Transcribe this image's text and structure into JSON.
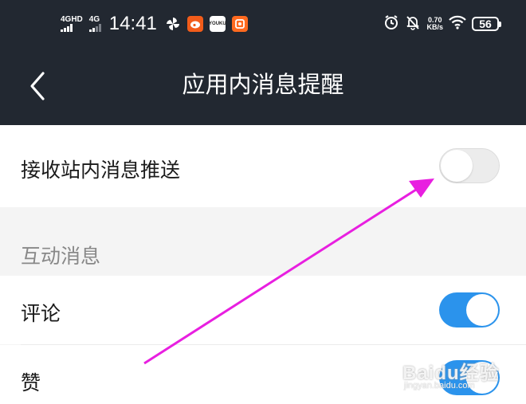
{
  "status_bar": {
    "network_1": "4GHD",
    "network_2": "4G",
    "time": "14:41",
    "app_icons": [
      "pinwheel-icon",
      "weibo-icon",
      "youku-icon",
      "orange-app-icon"
    ],
    "youku_text": "YOUKU",
    "speed_value": "0.70",
    "speed_unit": "KB/s",
    "battery": "56"
  },
  "header": {
    "title": "应用内消息提醒",
    "back_icon": "chevron-left-icon"
  },
  "settings": {
    "push": {
      "label": "接收站内消息推送",
      "enabled": false
    },
    "section_title": "互动消息",
    "comment": {
      "label": "评论",
      "enabled": true
    },
    "like": {
      "label": "赞",
      "enabled": true
    }
  },
  "watermark": {
    "main": "Baidu经验",
    "sub": "jingyan.baidu.com"
  },
  "colors": {
    "header_bg": "#222831",
    "toggle_on": "#2b93ec",
    "toggle_off": "#ececec",
    "arrow": "#e81fe0"
  }
}
